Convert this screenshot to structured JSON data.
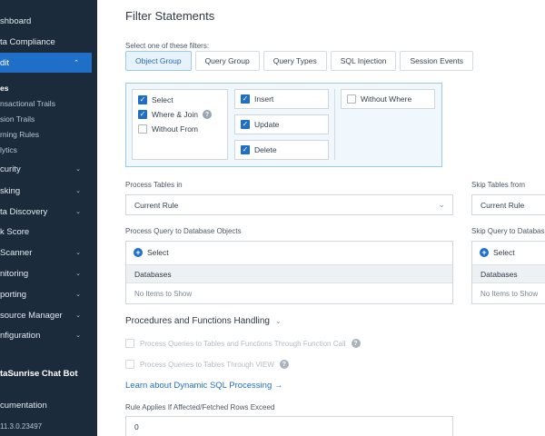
{
  "sidebar": {
    "items": [
      {
        "label": "shboard"
      },
      {
        "label": "ta Compliance"
      },
      {
        "label": "dit"
      },
      {
        "label": "es"
      },
      {
        "label": "nsactional Trails"
      },
      {
        "label": "sion Trails"
      },
      {
        "label": "rning Rules"
      },
      {
        "label": "lytics"
      },
      {
        "label": "curity"
      },
      {
        "label": "sking"
      },
      {
        "label": "ta Discovery"
      },
      {
        "label": "k Score"
      },
      {
        "label": " Scanner"
      },
      {
        "label": "nitoring"
      },
      {
        "label": "porting"
      },
      {
        "label": "source Manager"
      },
      {
        "label": "nfiguration"
      },
      {
        "label": "taSunrise Chat Bot"
      },
      {
        "label": "cumentation"
      },
      {
        "label": "11.3.0.23497"
      }
    ]
  },
  "page": {
    "title": "Filter Statements",
    "hint": "Select one of these filters:"
  },
  "tabs": [
    "Object Group",
    "Query Group",
    "Query Types",
    "SQL Injection",
    "Session Events"
  ],
  "filters": {
    "col1": [
      {
        "label": "Select",
        "checked": true
      },
      {
        "label": "Where & Join",
        "checked": true
      },
      {
        "label": "Without From",
        "checked": false
      }
    ],
    "col2": [
      {
        "label": "Insert",
        "checked": true
      },
      {
        "label": "Update",
        "checked": true
      },
      {
        "label": "Delete",
        "checked": true
      }
    ],
    "col3": [
      {
        "label": "Without Where",
        "checked": false
      }
    ]
  },
  "process_tables": {
    "label": "Process Tables in",
    "value": "Current Rule"
  },
  "skip_tables": {
    "label": "Skip Tables from",
    "value": "Current Rule"
  },
  "process_query": {
    "label": "Process Query to Database Objects",
    "select": "Select",
    "header": "Databases",
    "empty": "No Items to Show"
  },
  "skip_query": {
    "label": "Skip Query to Databas",
    "select": "Select",
    "header": "Databases",
    "empty": "No Items to Show"
  },
  "procedures": {
    "title": "Procedures and Functions Handling",
    "option1": "Process Queries to Tables and Functions Through Function Call",
    "option2": "Process Queries to Tables Through VIEW"
  },
  "learn_link": "Learn about Dynamic SQL Processing →",
  "rows_threshold": {
    "label": "Rule Applies If Affected/Fetched Rows Exceed",
    "value": "0"
  },
  "colors": {
    "accent": "#1f6fc9",
    "sidebar": "#1c2b3b"
  }
}
